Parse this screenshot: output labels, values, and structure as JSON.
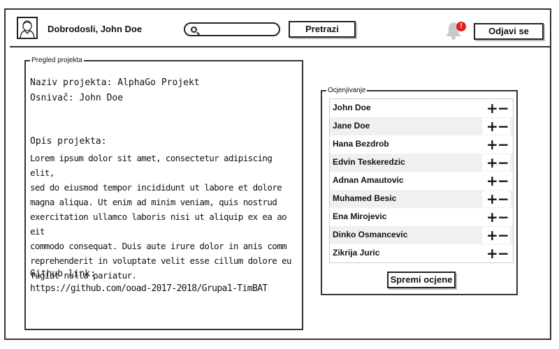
{
  "header": {
    "welcome": "Dobrodosli, John Doe",
    "search_button": "Pretrazi",
    "logout_button": "Odjavi se",
    "notification_count": "!",
    "accent_color": "#e02020"
  },
  "project": {
    "legend": "Pregled projekta",
    "name_line": "Naziv projekta: AlphaGo Projekt",
    "founder_line": "Osnivač: John Doe",
    "desc_heading": "Opis projekta:",
    "desc_lines": [
      "Lorem ipsum dolor sit amet, consectetur adipiscing elit,",
      "sed do eiusmod tempor incididunt ut labore et dolore",
      "magna aliqua. Ut enim ad minim veniam, quis nostrud",
      "exercitation ullamco laboris nisi ut aliquip ex ea ao eit",
      "commodo consequat. Duis aute irure dolor in anis comm",
      "reprehenderit in voluptate velit esse cillum dolore eu",
      "fugiat nulla pariatur."
    ],
    "github_label": "Github link:",
    "github_url": "https://github.com/ooad-2017-2018/Grupa1-TimBAT"
  },
  "rating": {
    "legend": "Ocjenjivanje",
    "plus": "+",
    "minus": "−",
    "members": [
      "John Doe",
      "Jane Doe",
      "Hana Bezdrob",
      "Edvin Teskeredzic",
      "Adnan Amautovic",
      "Muhamed Besic",
      "Ena Mirojevic",
      "Dinko Osmancevic",
      "Zikrija Juric"
    ],
    "save_button": "Spremi ocjene"
  }
}
